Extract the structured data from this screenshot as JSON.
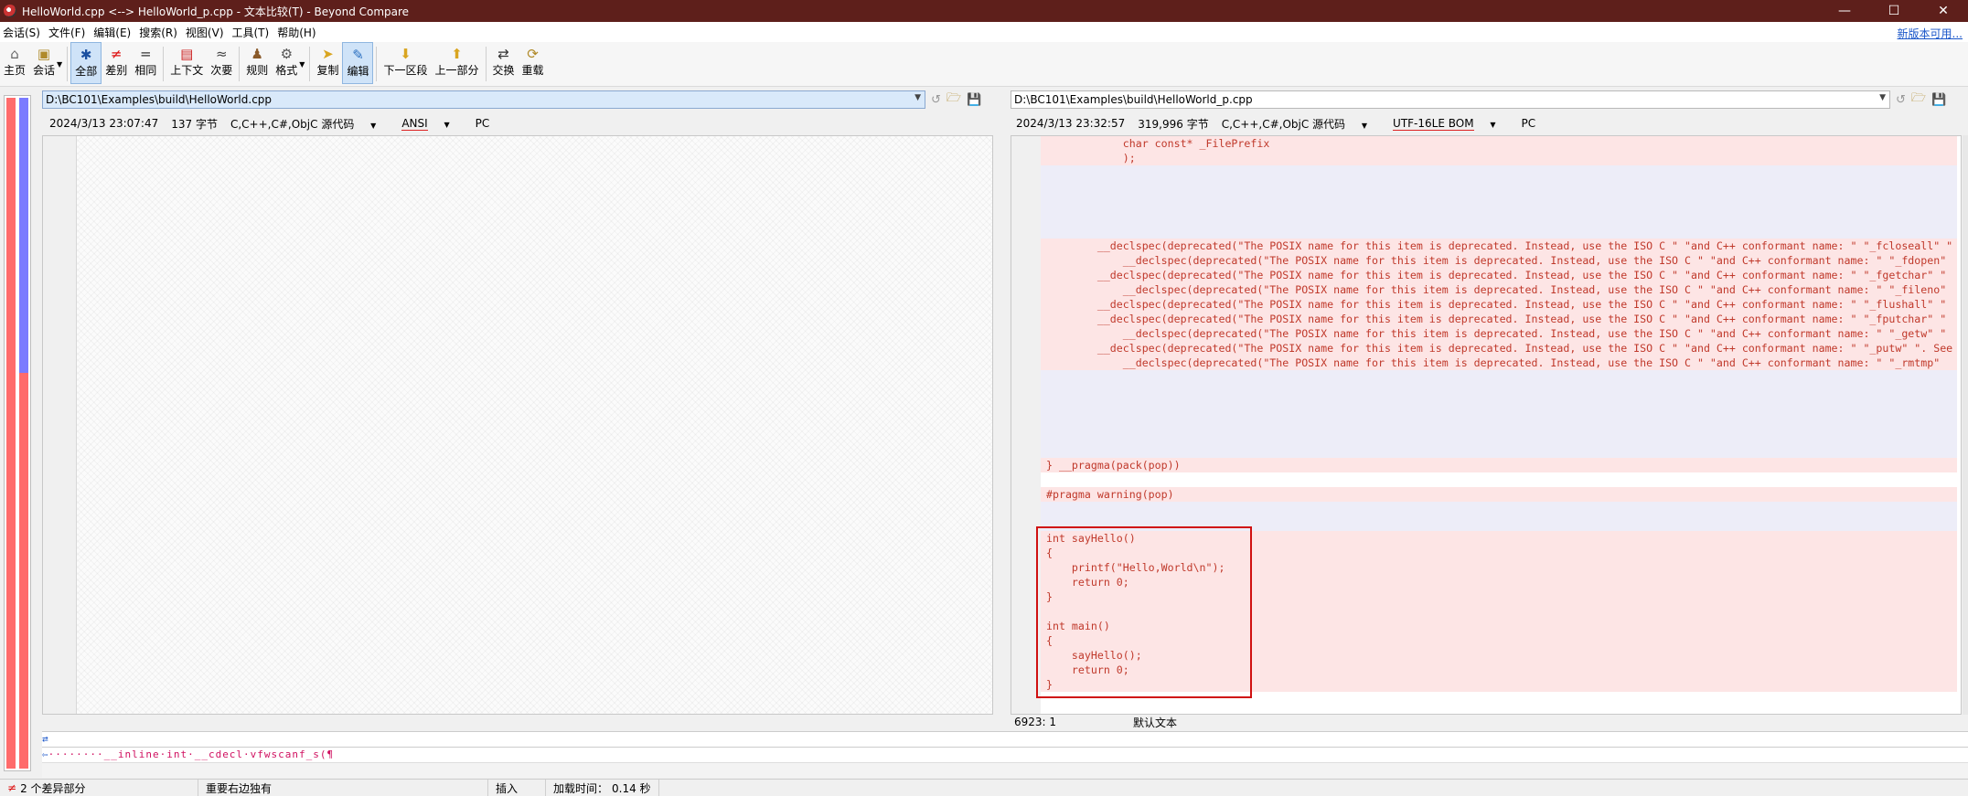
{
  "window": {
    "title": "HelloWorld.cpp <--> HelloWorld_p.cpp - 文本比较(T) - Beyond Compare"
  },
  "menu": [
    "会话(S)",
    "文件(F)",
    "编辑(E)",
    "搜索(R)",
    "视图(V)",
    "工具(T)",
    "帮助(H)"
  ],
  "update_link": "新版本可用...",
  "toolbar": {
    "home": "主页",
    "session": "会话",
    "all": "全部",
    "diffs": "差别",
    "same": "相同",
    "context": "上下文",
    "minor": "次要",
    "rules": "规则",
    "format": "格式",
    "copy": "复制",
    "edit": "编辑",
    "next_section": "下一区段",
    "prev_part": "上一部分",
    "swap": "交换",
    "reload": "重载"
  },
  "left": {
    "path": "D:\\BC101\\Examples\\build\\HelloWorld.cpp",
    "date": "2024/3/13 23:07:47",
    "size": "137 字节",
    "format": "C,C++,C#,ObjC 源代码",
    "encoding": "ANSI",
    "eol": "PC"
  },
  "right": {
    "path": "D:\\BC101\\Examples\\build\\HelloWorld_p.cpp",
    "date": "2024/3/13 23:32:57",
    "size": "319,996 字节",
    "format": "C,C++,C#,ObjC 源代码",
    "encoding": "UTF-16LE BOM",
    "eol": "PC",
    "position": "6923: 1",
    "mode": "默认文本"
  },
  "code_lines": [
    "            char const* _FilePrefix",
    "            );",
    "",
    "",
    "",
    "",
    "",
    "        __declspec(deprecated(\"The POSIX name for this item is deprecated. Instead, use the ISO C \" \"and C++ conformant name: \" \"_fcloseall\" \"",
    "            __declspec(deprecated(\"The POSIX name for this item is deprecated. Instead, use the ISO C \" \"and C++ conformant name: \" \"_fdopen\"",
    "        __declspec(deprecated(\"The POSIX name for this item is deprecated. Instead, use the ISO C \" \"and C++ conformant name: \" \"_fgetchar\" \"",
    "            __declspec(deprecated(\"The POSIX name for this item is deprecated. Instead, use the ISO C \" \"and C++ conformant name: \" \"_fileno\"",
    "        __declspec(deprecated(\"The POSIX name for this item is deprecated. Instead, use the ISO C \" \"and C++ conformant name: \" \"_flushall\" \"",
    "        __declspec(deprecated(\"The POSIX name for this item is deprecated. Instead, use the ISO C \" \"and C++ conformant name: \" \"_fputchar\" \"",
    "            __declspec(deprecated(\"The POSIX name for this item is deprecated. Instead, use the ISO C \" \"and C++ conformant name: \" \"_getw\" \"",
    "        __declspec(deprecated(\"The POSIX name for this item is deprecated. Instead, use the ISO C \" \"and C++ conformant name: \" \"_putw\" \". See",
    "            __declspec(deprecated(\"The POSIX name for this item is deprecated. Instead, use the ISO C \" \"and C++ conformant name: \" \"_rmtmp\"",
    "",
    "",
    "",
    "",
    "",
    "",
    "} __pragma(pack(pop))",
    "",
    "#pragma warning(pop)",
    "",
    "",
    "int sayHello()",
    "{",
    "    printf(\"Hello,World\\n\");",
    "    return 0;",
    "}",
    "",
    "int main()",
    "{",
    "    sayHello();",
    "    return 0;",
    "}"
  ],
  "detail_line": "\t__inline int __cdecl vfwscanf_s(",
  "status": {
    "diff_count": "2 个差异部分",
    "important": "重要右边独有",
    "insert": "插入",
    "load_time_label": "加载时间：",
    "load_time": "0.14 秒"
  }
}
